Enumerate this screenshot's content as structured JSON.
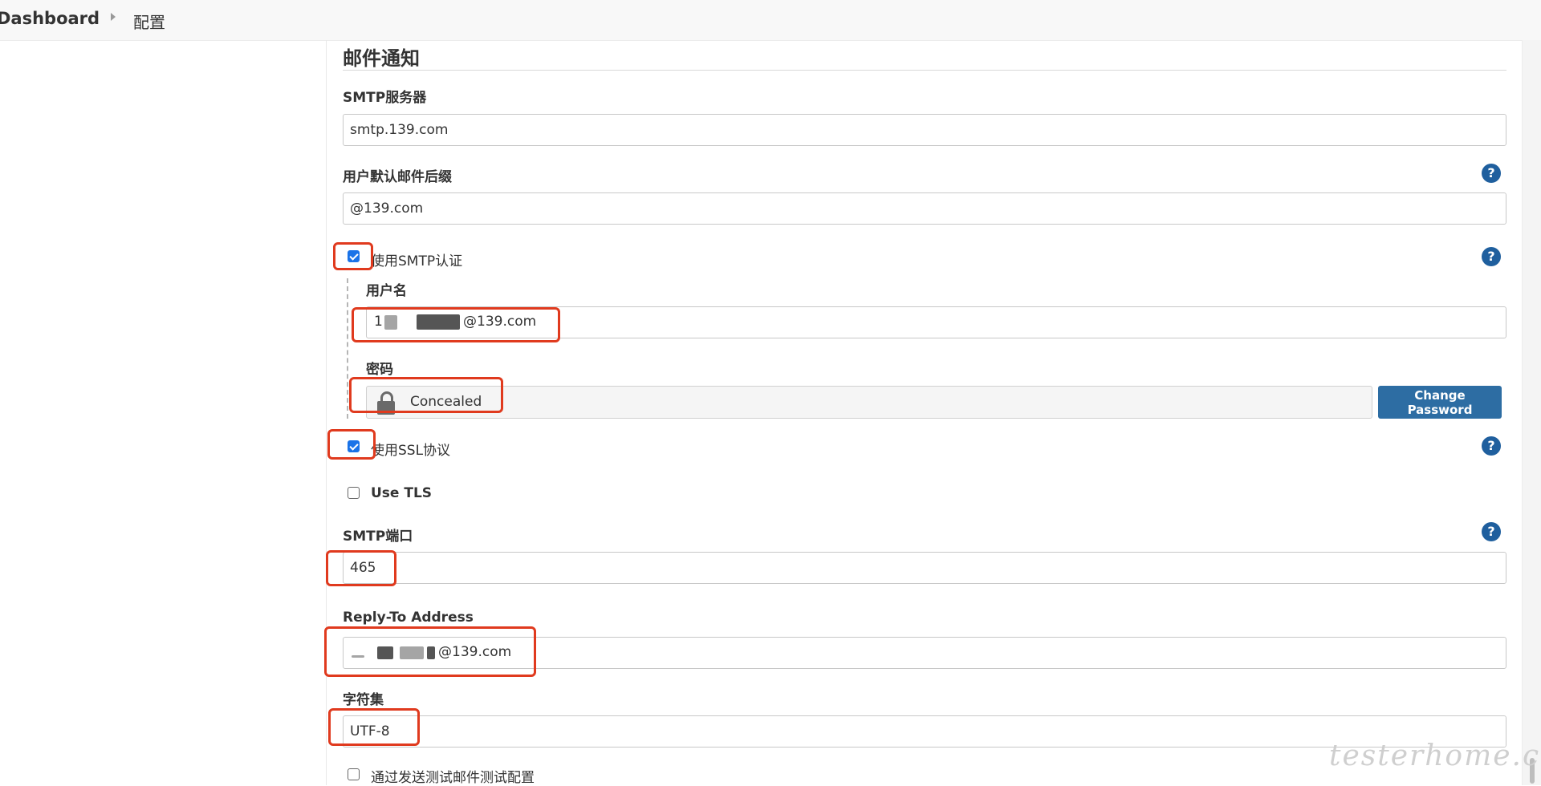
{
  "breadcrumb": {
    "dashboard": "Dashboard",
    "config": "配置"
  },
  "section": {
    "title": "邮件通知"
  },
  "smtp_server": {
    "label": "SMTP服务器",
    "value": "smtp.139.com"
  },
  "default_suffix": {
    "label": "用户默认邮件后缀",
    "value": "@139.com"
  },
  "smtp_auth": {
    "label": "使用SMTP认证",
    "checked": true,
    "username_label": "用户名",
    "username_prefix": "1",
    "username_suffix": "@139.com",
    "password_label": "密码",
    "password_display": "Concealed",
    "change_password_label": "Change Password"
  },
  "ssl": {
    "label": "使用SSL协议",
    "checked": true
  },
  "tls": {
    "label": "Use TLS",
    "checked": false
  },
  "smtp_port": {
    "label": "SMTP端口",
    "value": "465"
  },
  "reply_to": {
    "label": "Reply-To Address",
    "value_suffix": "@139.com"
  },
  "charset": {
    "label": "字符集",
    "value": "UTF-8"
  },
  "test_config": {
    "label": "通过发送测试邮件测试配置",
    "checked": false
  },
  "help_icon_glyph": "?",
  "watermark": "testerhome.com",
  "colors": {
    "accent_blue": "#1f5f9e",
    "button_blue": "#2d6da3",
    "highlight_red": "#e03a1e",
    "checkbox_blue": "#1a73e8"
  }
}
